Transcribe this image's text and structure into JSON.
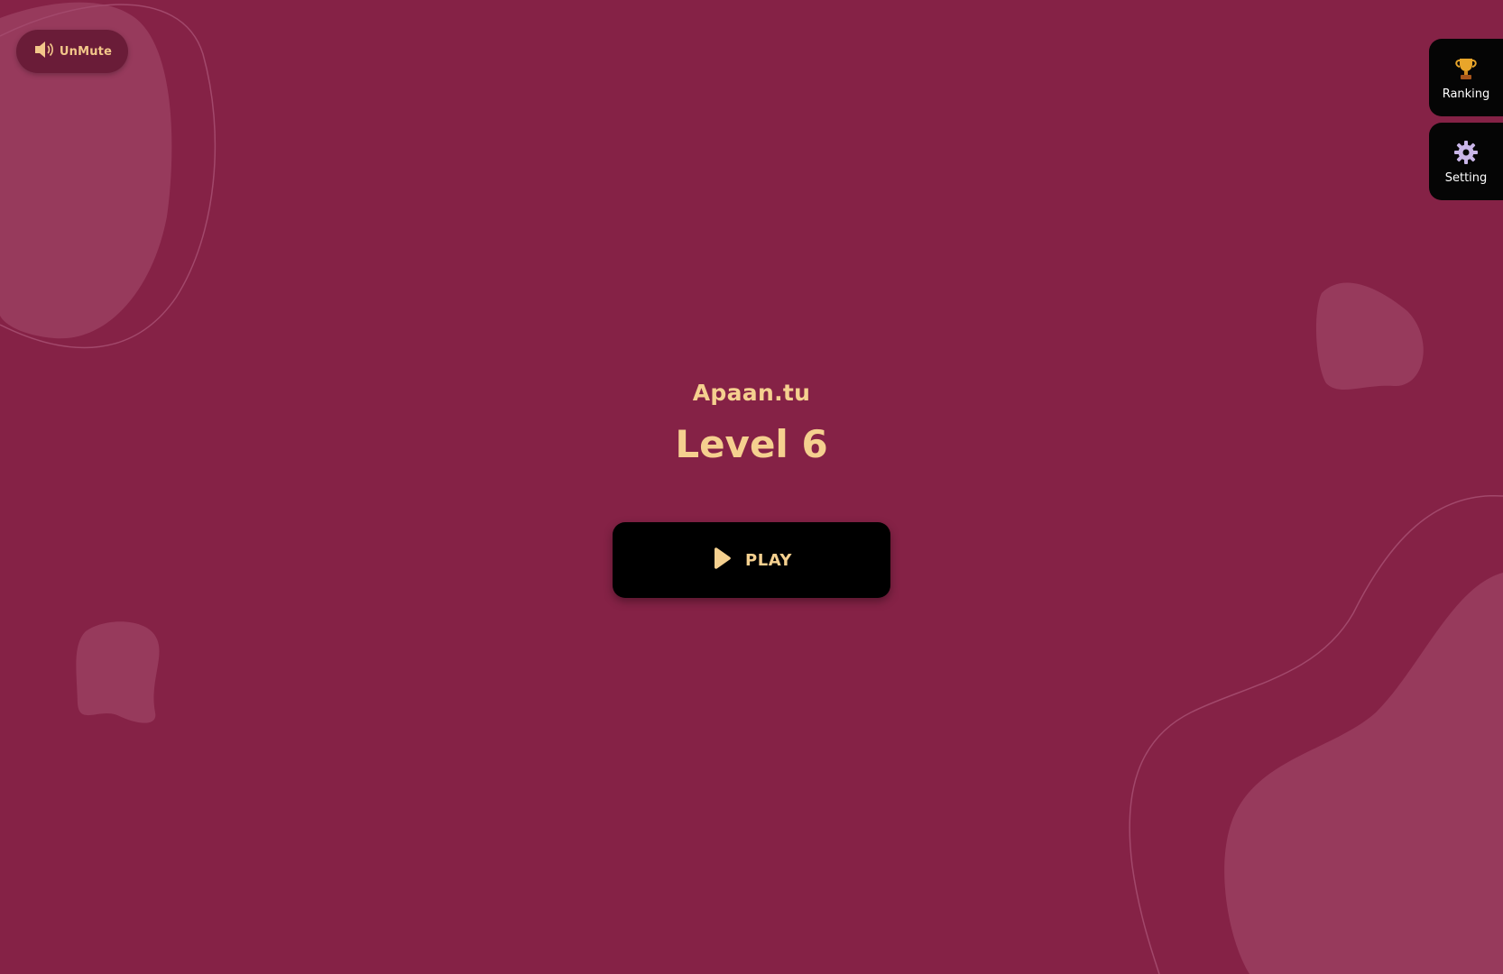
{
  "colors": {
    "background": "#852246",
    "blob": "#973a5c",
    "accent_text": "#f5d08f",
    "button_bg": "#000000"
  },
  "sound": {
    "label": "UnMute",
    "icon": "speaker-icon"
  },
  "side_menu": {
    "ranking_label": "Ranking",
    "ranking_icon": "trophy-icon",
    "setting_label": "Setting",
    "setting_icon": "gear-icon"
  },
  "game": {
    "app_name": "Apaan.tu",
    "level": "Level 6",
    "play_label": "PLAY",
    "play_icon": "play-icon"
  }
}
